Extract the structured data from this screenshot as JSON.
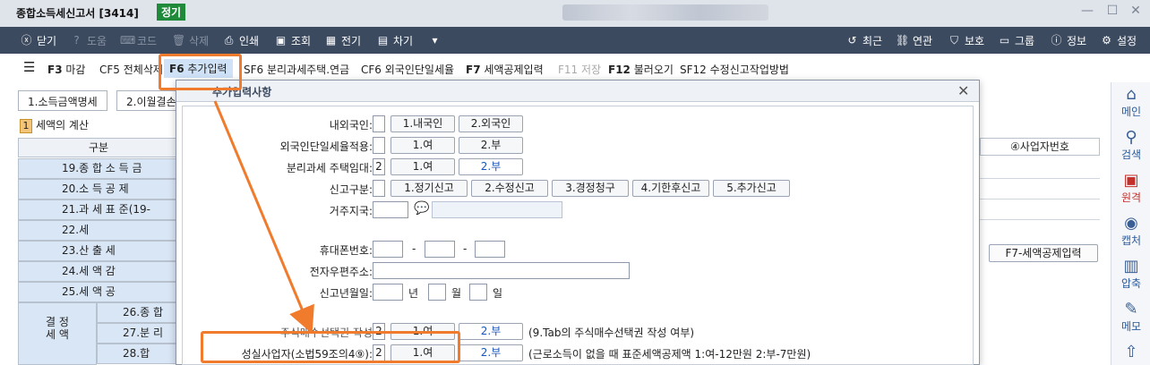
{
  "window": {
    "title": "종합소득세신고서 [3414]",
    "badge": "정기"
  },
  "toolbar": {
    "close": "닫기",
    "help": "도움",
    "code": "코드",
    "delete": "삭제",
    "print": "인쇄",
    "lookup": "조회",
    "prev": "전기",
    "next": "차기",
    "recent": "최근",
    "related": "연관",
    "protect": "보호",
    "group": "그룹",
    "info": "정보",
    "settings": "설정"
  },
  "fkeys": [
    {
      "key": "F3",
      "label": "마감"
    },
    {
      "key": "CF5",
      "label": "전체삭제"
    },
    {
      "key": "F6",
      "label": "추가입력"
    },
    {
      "key": "SF6",
      "label": "분리과세주택.연금"
    },
    {
      "key": "CF6",
      "label": "외국인단일세율"
    },
    {
      "key": "F7",
      "label": "세액공제입력"
    },
    {
      "key": "F11",
      "label": "저장"
    },
    {
      "key": "F12",
      "label": "불러오기"
    },
    {
      "key": "SF12",
      "label": "수정신고작업방법"
    }
  ],
  "right_sidebar": [
    {
      "icon": "home-icon",
      "label": "메인"
    },
    {
      "icon": "search-icon",
      "label": "검색"
    },
    {
      "icon": "remote-icon",
      "label": "원격"
    },
    {
      "icon": "camera-icon",
      "label": "캡처"
    },
    {
      "icon": "compress-icon",
      "label": "압축"
    },
    {
      "icon": "memo-icon",
      "label": "메모"
    }
  ],
  "background": {
    "tabs": [
      "1.소득금액명세",
      "2.이월결손"
    ],
    "section_num": "1",
    "section_title": "세액의 계산",
    "table_header": "구분",
    "rows": [
      "19.종 합 소 득 금",
      "20.소 득 공 제",
      "21.과 세 표 준(19-",
      "22.세",
      "23.산 출 세",
      "24.세 액 감",
      "25.세 액 공"
    ],
    "left_group": "결 정\n세 액",
    "sub_rows": [
      "26.종 합",
      "27.분 리",
      "28.합"
    ],
    "right_header": "④사업자번호",
    "f7_button": "F7-세액공제입력"
  },
  "modal": {
    "title": "추가입력사항",
    "fields": {
      "nationality": {
        "label": "내외국인:",
        "value": "",
        "options": [
          "1.내국인",
          "2.외국인"
        ]
      },
      "foreign_flat": {
        "label": "외국인단일세율적용:",
        "value": "",
        "options": [
          "1.여",
          "2.부"
        ]
      },
      "separate_rent": {
        "label": "분리과세 주택임대:",
        "value": "2",
        "options": [
          "1.여",
          "2.부"
        ]
      },
      "report_type": {
        "label": "신고구분:",
        "value": "",
        "options": [
          "1.정기신고",
          "2.수정신고",
          "3.경정청구",
          "4.기한후신고",
          "5.추가신고"
        ]
      },
      "residence": {
        "label": "거주지국:",
        "value": ""
      },
      "mobile": {
        "label": "휴대폰번호:",
        "sep": "-"
      },
      "email": {
        "label": "전자우편주소:"
      },
      "report_date": {
        "label": "신고년월일:",
        "year": "년",
        "month": "월",
        "day": "일"
      },
      "stock_purchase": {
        "label": "주식매수선택권 작성",
        "value": "2",
        "options": [
          "1.여",
          "2.부"
        ],
        "note": "(9.Tab의 주식매수선택권 작성 여부)"
      },
      "faithful_business": {
        "label": "성실사업자(소법59조의4⑨):",
        "value": "2",
        "options": [
          "1.여",
          "2.부"
        ],
        "note": "(근로소득이 없을 때 표준세액공제액 1:여-12만원 2:부-7만원)"
      }
    }
  },
  "colors": {
    "highlight": "#f07b2c",
    "toolbar_bg": "#3c4a60",
    "badge_bg": "#1f8a3a"
  }
}
